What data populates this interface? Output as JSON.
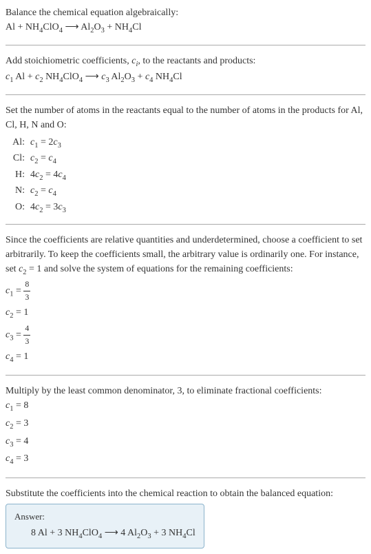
{
  "section1": {
    "title": "Balance the chemical equation algebraically:",
    "eq_lhs1": "Al + NH",
    "eq_sub1": "4",
    "eq_part2": "ClO",
    "eq_sub2": "4",
    "arrow": " ⟶ ",
    "eq_rhs1": "Al",
    "eq_sub3": "2",
    "eq_part3": "O",
    "eq_sub4": "3",
    "eq_part4": " + NH",
    "eq_sub5": "4",
    "eq_part5": "Cl"
  },
  "section2": {
    "title1": "Add stoichiometric coefficients, ",
    "ci": "c",
    "ci_sub": "i",
    "title2": ", to the reactants and products:",
    "c1": "c",
    "c1s": "1",
    "p1": " Al + ",
    "c2": "c",
    "c2s": "2",
    "p2": " NH",
    "p2sub": "4",
    "p3": "ClO",
    "p3sub": "4",
    "arrow": " ⟶ ",
    "c3": "c",
    "c3s": "3",
    "p4": " Al",
    "p4sub": "2",
    "p5": "O",
    "p5sub": "3",
    "p6": " + ",
    "c4": "c",
    "c4s": "4",
    "p7": " NH",
    "p7sub": "4",
    "p8": "Cl"
  },
  "section3": {
    "title": "Set the number of atoms in the reactants equal to the number of atoms in the products for Al, Cl, H, N and O:",
    "rows": [
      {
        "label": "Al:",
        "c_a": "c",
        "sub_a": "1",
        "op": " = 2",
        "c_b": "c",
        "sub_b": "3"
      },
      {
        "label": "Cl:",
        "c_a": "c",
        "sub_a": "2",
        "op": " = ",
        "c_b": "c",
        "sub_b": "4"
      },
      {
        "label": "H:",
        "pre": "4",
        "c_a": "c",
        "sub_a": "2",
        "op": " = 4",
        "c_b": "c",
        "sub_b": "4"
      },
      {
        "label": "N:",
        "c_a": "c",
        "sub_a": "2",
        "op": " = ",
        "c_b": "c",
        "sub_b": "4"
      },
      {
        "label": "O:",
        "pre": "4",
        "c_a": "c",
        "sub_a": "2",
        "op": " = 3",
        "c_b": "c",
        "sub_b": "3"
      }
    ]
  },
  "section4": {
    "text1": "Since the coefficients are relative quantities and underdetermined, choose a coefficient to set arbitrarily. To keep the coefficients small, the arbitrary value is ordinarily one. For instance, set ",
    "c2": "c",
    "c2s": "2",
    "text2": " = 1 and solve the system of equations for the remaining coefficients:",
    "l1_c": "c",
    "l1_s": "1",
    "l1_eq": " = ",
    "l1_num": "8",
    "l1_den": "3",
    "l2_c": "c",
    "l2_s": "2",
    "l2_eq": " = 1",
    "l3_c": "c",
    "l3_s": "3",
    "l3_eq": " = ",
    "l3_num": "4",
    "l3_den": "3",
    "l4_c": "c",
    "l4_s": "4",
    "l4_eq": " = 1"
  },
  "section5": {
    "title": "Multiply by the least common denominator, 3, to eliminate fractional coefficients:",
    "l1_c": "c",
    "l1_s": "1",
    "l1_v": " = 8",
    "l2_c": "c",
    "l2_s": "2",
    "l2_v": " = 3",
    "l3_c": "c",
    "l3_s": "3",
    "l3_v": " = 4",
    "l4_c": "c",
    "l4_s": "4",
    "l4_v": " = 3"
  },
  "section6": {
    "title": "Substitute the coefficients into the chemical reaction to obtain the balanced equation:",
    "answer_label": "Answer:",
    "ans1": "8 Al + 3 NH",
    "ans_sub1": "4",
    "ans2": "ClO",
    "ans_sub2": "4",
    "arrow": " ⟶ ",
    "ans3": "4 Al",
    "ans_sub3": "2",
    "ans4": "O",
    "ans_sub4": "3",
    "ans5": " + 3 NH",
    "ans_sub5": "4",
    "ans6": "Cl"
  },
  "chart_data": {
    "type": "table",
    "title": "Balancing chemical equation Al + NH4ClO4 -> Al2O3 + NH4Cl",
    "atom_balance_equations": [
      {
        "element": "Al",
        "equation": "c1 = 2*c3"
      },
      {
        "element": "Cl",
        "equation": "c2 = c4"
      },
      {
        "element": "H",
        "equation": "4*c2 = 4*c4"
      },
      {
        "element": "N",
        "equation": "c2 = c4"
      },
      {
        "element": "O",
        "equation": "4*c2 = 3*c3"
      }
    ],
    "solution_c2_equals_1": {
      "c1": "8/3",
      "c2": 1,
      "c3": "4/3",
      "c4": 1
    },
    "integer_coefficients": {
      "c1": 8,
      "c2": 3,
      "c3": 4,
      "c4": 3
    },
    "balanced_equation": "8 Al + 3 NH4ClO4 -> 4 Al2O3 + 3 NH4Cl"
  }
}
